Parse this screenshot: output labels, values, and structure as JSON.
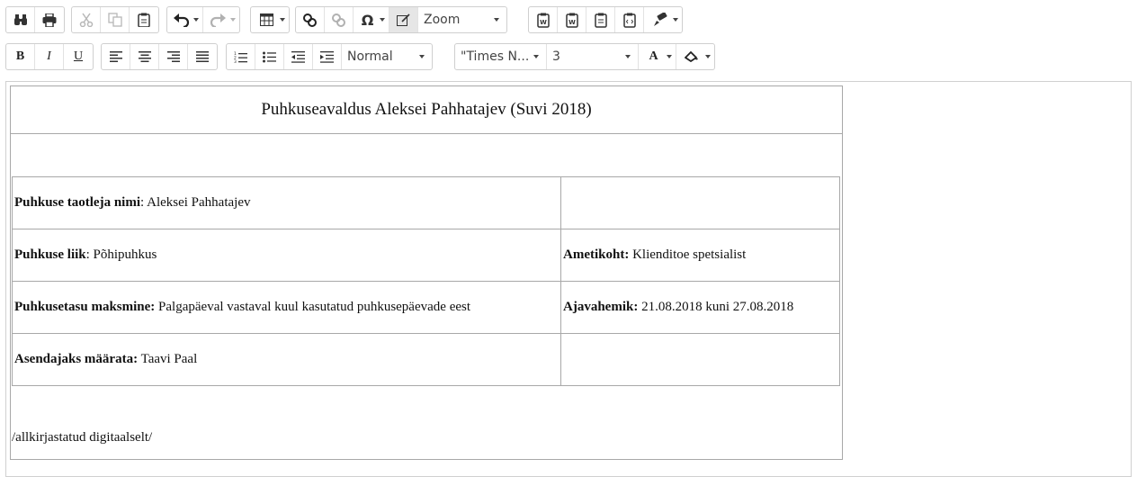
{
  "toolbar": {
    "zoom_label": "Zoom",
    "format_label": "Normal",
    "font_label": "\"Times N...",
    "size_label": "3",
    "bold_label": "B",
    "italic_label": "I",
    "underline_label": "U",
    "textcolor_label": "A",
    "special_char_label": "Ω"
  },
  "document": {
    "title": "Puhkuseavaldus Aleksei Pahhatajev (Suvi 2018)",
    "rows": [
      {
        "left_label": "Puhkuse taotleja nimi",
        "left_sep": ":",
        "left_value": " Aleksei Pahhatajev",
        "right_label": "",
        "right_value": ""
      },
      {
        "left_label": "Puhkuse liik",
        "left_sep": ":",
        "left_value": " Põhipuhkus",
        "right_label": "Ametikoht:",
        "right_value": " Klienditoe spetsialist"
      },
      {
        "left_label": "Puhkusetasu maksmine:",
        "left_sep": "",
        "left_value": " Palgapäeval vastaval kuul kasutatud puhkusepäevade eest",
        "right_label": "Ajavahemik:",
        "right_value": " 21.08.2018 kuni 27.08.2018"
      },
      {
        "left_label": "Asendajaks määrata:",
        "left_sep": "",
        "left_value": " Taavi Paal",
        "right_label": "",
        "right_value": ""
      }
    ],
    "signature": "/allkirjastatud digitaalselt/"
  }
}
